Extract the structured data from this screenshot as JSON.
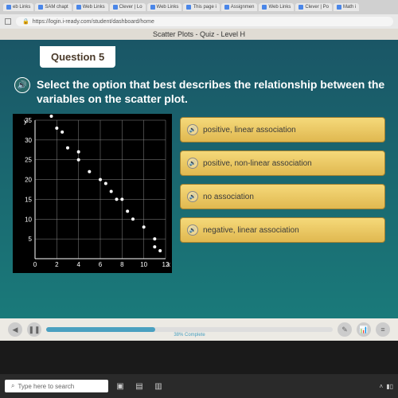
{
  "browser": {
    "tabs": [
      {
        "label": "eb Links"
      },
      {
        "label": "SAM chapt"
      },
      {
        "label": "Web Links"
      },
      {
        "label": "Clever | Lo"
      },
      {
        "label": "Web Links"
      },
      {
        "label": "This page i"
      },
      {
        "label": "Assignmen"
      },
      {
        "label": "Web Links"
      },
      {
        "label": "Clever | Po"
      },
      {
        "label": "Math i"
      }
    ],
    "url": "https://login.i-ready.com/student/dashboard/home"
  },
  "page": {
    "title": "Scatter Plots - Quiz - Level H"
  },
  "question": {
    "label": "Question 5",
    "prompt": "Select the option that best describes the relationship between the variables on the scatter plot.",
    "options": [
      {
        "text": "positive, linear association"
      },
      {
        "text": "positive, non-linear association"
      },
      {
        "text": "no association"
      },
      {
        "text": "negative, linear association"
      }
    ]
  },
  "chart_data": {
    "type": "scatter",
    "xlabel": "x",
    "ylabel": "y",
    "xlim": [
      0,
      12
    ],
    "ylim": [
      0,
      35
    ],
    "xticks": [
      0,
      2,
      4,
      6,
      8,
      10,
      12
    ],
    "yticks": [
      5,
      10,
      15,
      20,
      25,
      30,
      35
    ],
    "points": [
      {
        "x": 1.5,
        "y": 36
      },
      {
        "x": 2,
        "y": 33
      },
      {
        "x": 2.5,
        "y": 32
      },
      {
        "x": 3,
        "y": 28
      },
      {
        "x": 4,
        "y": 27
      },
      {
        "x": 4,
        "y": 25
      },
      {
        "x": 5,
        "y": 22
      },
      {
        "x": 6,
        "y": 20
      },
      {
        "x": 6.5,
        "y": 19
      },
      {
        "x": 7,
        "y": 17
      },
      {
        "x": 7.5,
        "y": 15
      },
      {
        "x": 8,
        "y": 15
      },
      {
        "x": 8.5,
        "y": 12
      },
      {
        "x": 9,
        "y": 10
      },
      {
        "x": 10,
        "y": 8
      },
      {
        "x": 11,
        "y": 5
      },
      {
        "x": 11,
        "y": 3
      },
      {
        "x": 11.5,
        "y": 2
      }
    ]
  },
  "player": {
    "progress_label": "38% Complete"
  },
  "taskbar": {
    "search_placeholder": "Type here to search"
  }
}
